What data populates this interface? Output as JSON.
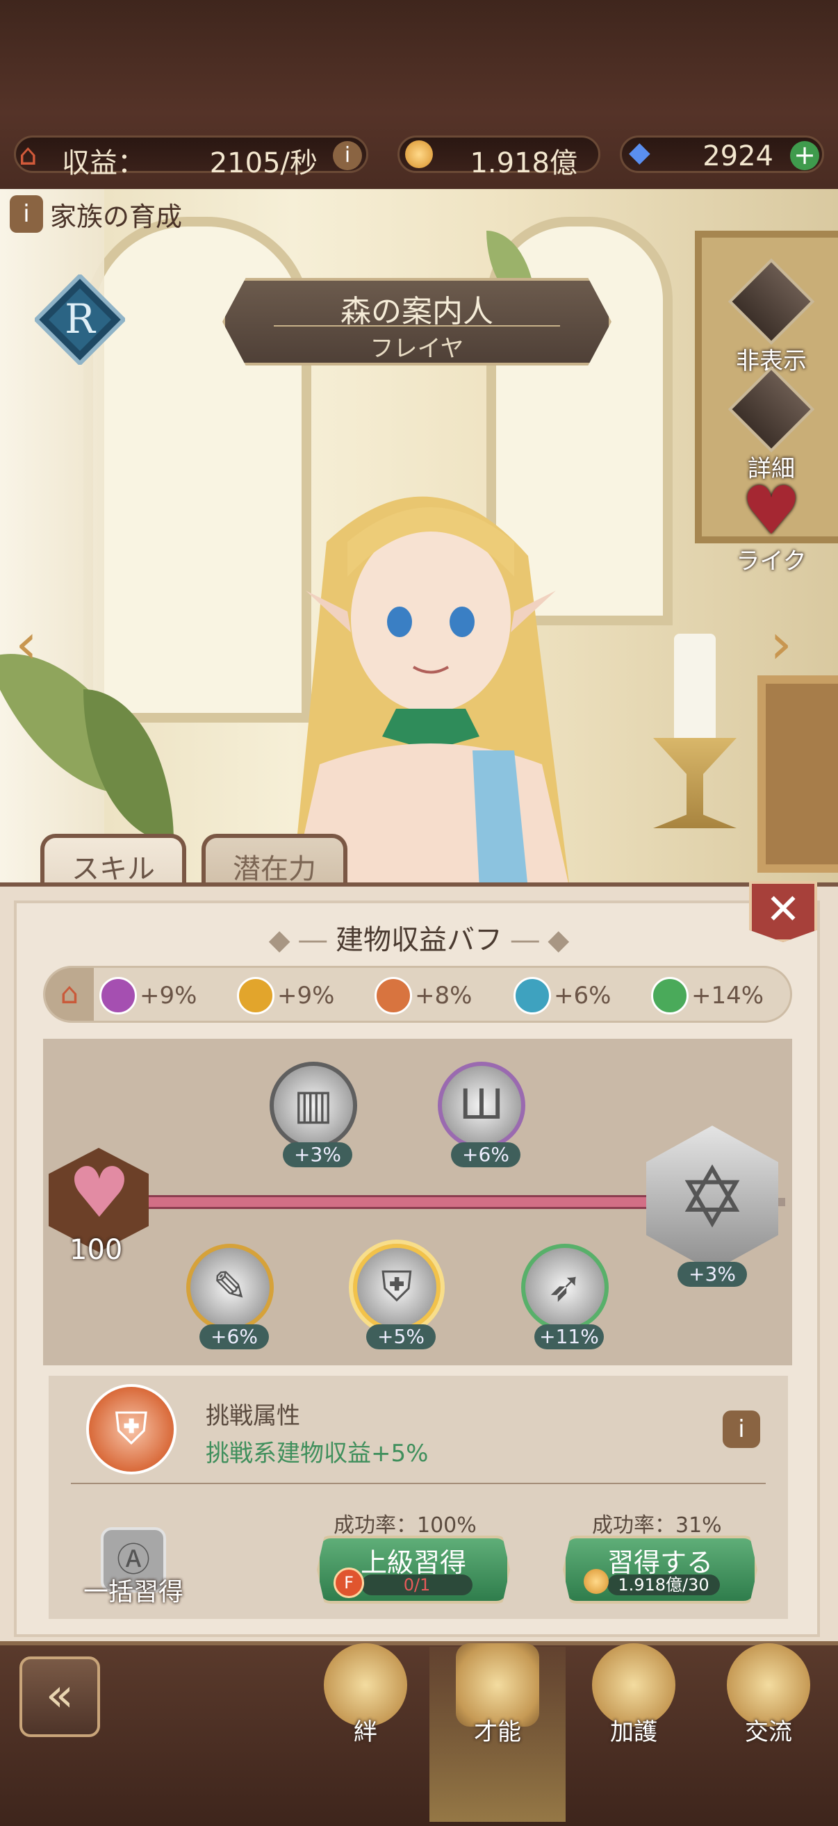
{
  "resources": {
    "income_label": "収益：",
    "income_value": "2105/秒",
    "gold_value": "1.918億",
    "gems_value": "2924"
  },
  "section_label": "家族の育成",
  "character": {
    "rank": "R",
    "title": "森の案内人",
    "name": "フレイヤ"
  },
  "side_buttons": {
    "hide": "非表示",
    "detail": "詳細",
    "like": "ライク"
  },
  "tabs": {
    "skill": "スキル",
    "potential": "潜在力"
  },
  "panel": {
    "title": "建物収益バフ",
    "buffs": [
      {
        "icon": "lyre-icon",
        "value": "+9%"
      },
      {
        "icon": "broom-icon",
        "value": "+9%"
      },
      {
        "icon": "sword-shield-icon",
        "value": "+8%"
      },
      {
        "icon": "book-icon",
        "value": "+6%"
      },
      {
        "icon": "wing-icon",
        "value": "+14%"
      }
    ],
    "heart_level": "100",
    "nodes_top": [
      "+3%",
      "+6%"
    ],
    "nodes_bottom": [
      "+6%",
      "+5%",
      "+11%"
    ],
    "final_node": "+3%"
  },
  "skill_info": {
    "name": "挑戦属性",
    "effect": "挑戦系建物収益+5%",
    "bulk_label": "一括習得",
    "adv_rate": "成功率：100%",
    "adv_label": "上級習得",
    "adv_cost": "0/1",
    "learn_rate": "成功率：31%",
    "learn_label": "習得する",
    "learn_cost": "1.918億/30"
  },
  "nav": {
    "bond": "絆",
    "talent": "才能",
    "protection": "加護",
    "exchange": "交流"
  },
  "colors": {
    "accent_green": "#3f8f5c",
    "panel_bg": "#efe5d8",
    "close_red": "#a7403a"
  }
}
